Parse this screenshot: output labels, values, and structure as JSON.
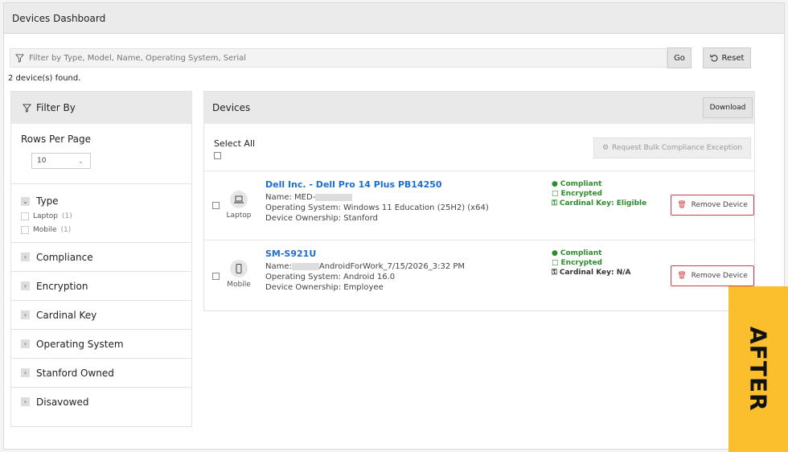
{
  "header": {
    "title": "Devices Dashboard"
  },
  "search": {
    "placeholder": "Filter by Type, Model, Name, Operating System, Serial",
    "go_label": "Go",
    "reset_label": "Reset"
  },
  "found_text": "2 device(s) found.",
  "filter_panel": {
    "title": "Filter By",
    "rows_per_page_label": "Rows Per Page",
    "rows_per_page_value": "10",
    "type_section": {
      "label": "Type",
      "options": [
        {
          "label": "Laptop",
          "count": "(1)"
        },
        {
          "label": "Mobile",
          "count": "(1)"
        }
      ]
    },
    "sections": [
      "Compliance",
      "Encryption",
      "Cardinal Key",
      "Operating System",
      "Stanford Owned",
      "Disavowed"
    ]
  },
  "devices_panel": {
    "title": "Devices",
    "download_label": "Download",
    "select_all_label": "Select All",
    "bulk_label": "Request Bulk Compliance Exception",
    "remove_label": "Remove Device",
    "devices": [
      {
        "type": "Laptop",
        "title": "Dell Inc. - Dell Pro 14 Plus PB14250",
        "name_label": "Name: MED-",
        "name_suffix": "",
        "os": "Operating System: Windows 11 Education (25H2) (x64)",
        "ownership": "Device Ownership: Stanford",
        "compliance": "Compliant",
        "encryption": "Encrypted",
        "cardinal_key": "Cardinal Key: Eligible"
      },
      {
        "type": "Mobile",
        "title": "SM-S921U",
        "name_label": "Name:",
        "name_suffix": "AndroidForWork_7/15/2026_3:32 PM",
        "os": "Operating System: Android 16.0",
        "ownership": "Device Ownership: Employee",
        "compliance": "Compliant",
        "encryption": "Encrypted",
        "cardinal_key": "Cardinal Key: N/A"
      }
    ]
  },
  "badge": {
    "text": "AFTER",
    "color": "#fbbf2e"
  },
  "colors": {
    "link": "#1a6fd0",
    "ok": "#2e8b2e",
    "danger": "#c9424b"
  }
}
